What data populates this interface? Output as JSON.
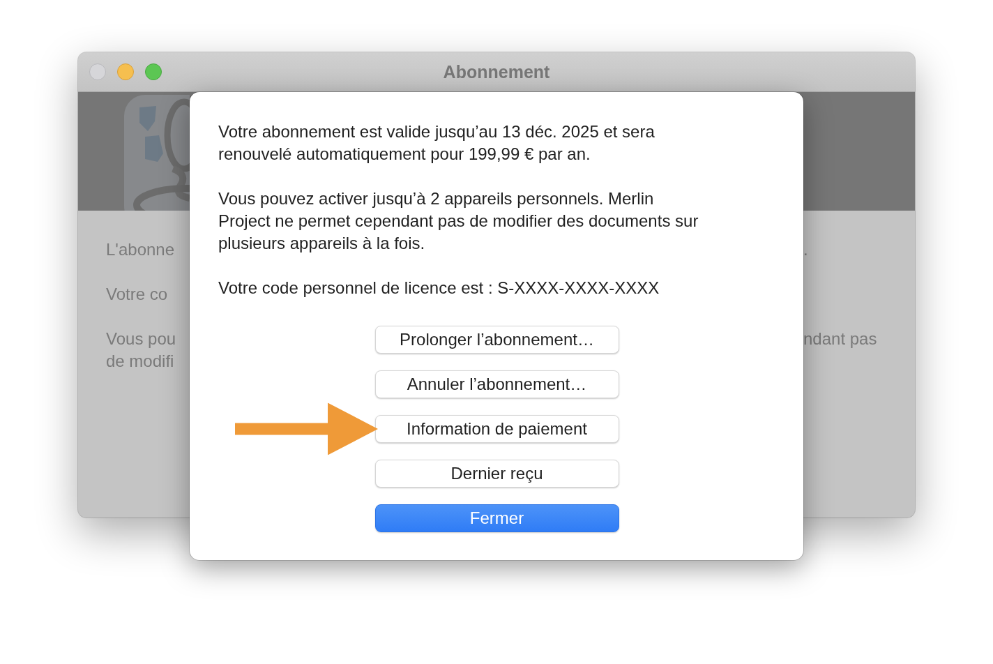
{
  "window": {
    "title": "Abonnement",
    "controls": [
      {
        "kind": "close",
        "disabled": true
      },
      {
        "kind": "minimize",
        "disabled": false
      },
      {
        "kind": "zoom",
        "disabled": false
      }
    ]
  },
  "background_paragraphs": [
    {
      "lines": [
        {
          "left": "L'abonne",
          "right": "."
        }
      ]
    },
    {
      "lines": [
        {
          "left": "Votre co"
        }
      ]
    },
    {
      "lines": [
        {
          "left": "Vous pou",
          "right": "ndant pas"
        },
        {
          "left": "de modifi"
        }
      ]
    }
  ],
  "dialog": {
    "paragraphs": [
      {
        "lines": [
          "Votre abonnement est valide jusqu’au 13 déc. 2025 et sera",
          "renouvelé automatiquement pour 199,99 € par an."
        ]
      },
      {
        "lines": [
          "Vous pouvez activer jusqu’à 2 appareils personnels. Merlin",
          "Project ne permet cependant pas de modifier des documents sur",
          "plusieurs appareils à la fois."
        ]
      },
      {
        "lines": [
          "Votre code personnel de licence est : S-XXXX-XXXX-XXXX"
        ]
      }
    ],
    "buttons": [
      {
        "label": "Prolonger l’abonnement…",
        "kind": "default",
        "highlighted": false
      },
      {
        "label": "Annuler l’abonnement…",
        "kind": "default",
        "highlighted": false
      },
      {
        "label": "Information de paiement",
        "kind": "default",
        "highlighted": true
      },
      {
        "label": "Dernier reçu",
        "kind": "default",
        "highlighted": false
      },
      {
        "label": "Fermer",
        "kind": "primary",
        "highlighted": false
      }
    ]
  }
}
